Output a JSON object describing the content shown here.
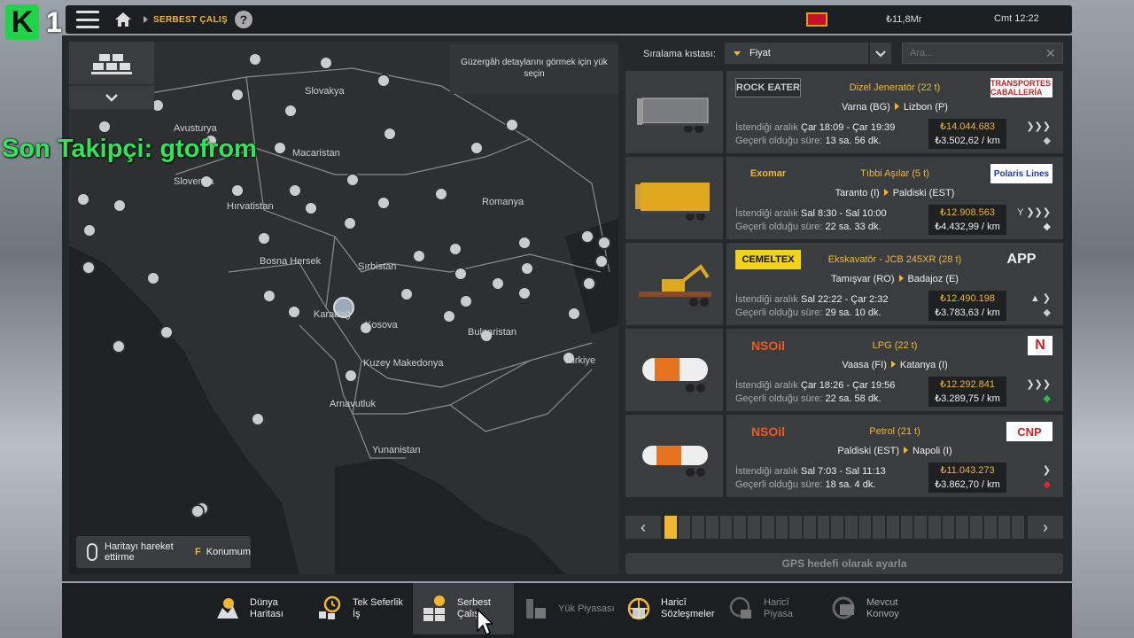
{
  "stream": {
    "logo_letter": "K",
    "logo_number": "1",
    "overlay": "Son Takipçi: gtofrom"
  },
  "topbar": {
    "breadcrumb": "SERBEST ÇALIŞ",
    "help": "?",
    "money": "₺11,8Mr",
    "time": "Cmt 12:22"
  },
  "map": {
    "tooltip": "Güzergâh detaylarını görmek için yük seçin",
    "hint_move": "Haritayı hareket ettirme",
    "hint_key": "F",
    "hint_location": "Konumum",
    "labels": {
      "bulgaria": "Bulgaristan",
      "romania": "Romanya",
      "serbia": "Sırbistan",
      "bosnia": "Bosna Hersek",
      "croatia": "Hırvatistan",
      "slovenia": "Slovenya",
      "hungary": "Macaristan",
      "slovakia": "Slovakya",
      "austria": "Avusturya",
      "kosovo": "Kosova",
      "macedonia": "Kuzey Makedonya",
      "albania": "Arnavutluk",
      "greece": "Yunanistan",
      "turkey": "Türkiye",
      "montenegro": "Karadağ"
    }
  },
  "sort": {
    "label": "Sıralama kıstası:",
    "value": "Fiyat",
    "search_placeholder": "Ara..."
  },
  "jobs": [
    {
      "company": "ROCK EATER",
      "cargo": "Dizel Jeneratör (22 t)",
      "destination_company": "TRANSPORTES CABALLERÍA",
      "from": "Varna (BG)",
      "to": "Lizbon (P)",
      "range_label": "İstendiği aralık",
      "range": "Çar 18:09 - Çar 19:39",
      "valid_label": "Geçerli olduğu süre:",
      "valid": "13 sa. 56 dk.",
      "price": "₺14.044.683",
      "per_km": "₺3.502,62 / km"
    },
    {
      "company": "Exomar",
      "cargo": "Tıbbi Aşılar (5 t)",
      "destination_company": "Polaris Lines",
      "from": "Taranto (I)",
      "to": "Paldiski (EST)",
      "range_label": "İstendiği aralık",
      "range": "Sal 8:30 - Sal 10:00",
      "valid_label": "Geçerli olduğu süre:",
      "valid": "22 sa. 33 dk.",
      "price": "₺12.908.563",
      "per_km": "₺4.432,99 / km"
    },
    {
      "company": "CEMELTEX",
      "cargo": "Ekskavatör - JCB 245XR (28 t)",
      "destination_company": "APP",
      "from": "Tamışvar (RO)",
      "to": "Badajoz (E)",
      "range_label": "İstendiği aralık",
      "range": "Sal 22:22 - Çar 2:32",
      "valid_label": "Geçerli olduğu süre:",
      "valid": "29 sa. 10 dk.",
      "price": "₺12.490.198",
      "per_km": "₺3.783,63 / km"
    },
    {
      "company": "NSOil",
      "cargo": "LPG (22 t)",
      "destination_company": "N",
      "from": "Vaasa (FI)",
      "to": "Katanya (I)",
      "range_label": "İstendiği aralık",
      "range": "Çar 18:26 - Çar 19:56",
      "valid_label": "Geçerli olduğu süre:",
      "valid": "22 sa. 58 dk.",
      "price": "₺12.292.841",
      "per_km": "₺3.289,75 / km"
    },
    {
      "company": "NSOil",
      "cargo": "Petrol (21 t)",
      "destination_company": "CNP",
      "from": "Paldiski (EST)",
      "to": "Napoli (I)",
      "range_label": "İstendiği aralık",
      "range": "Sal 7:03 - Sal 11:13",
      "valid_label": "Geçerli olduğu süre:",
      "valid": "18 sa. 4 dk.",
      "price": "₺11.043.273",
      "per_km": "₺3.862,70 / km"
    }
  ],
  "pager": {
    "prev": "‹",
    "next": "›",
    "total_pages": 26,
    "current": 1
  },
  "gps_button": "GPS hedefi olarak ayarla",
  "tabs": [
    {
      "label": "Dünya Haritası"
    },
    {
      "label": "Tek Seferlik İş"
    },
    {
      "label": "Serbest Çalış"
    },
    {
      "label": "Yük Piyasası"
    },
    {
      "label": "Haricî Sözleşmeler"
    },
    {
      "label": "Haricî Piyasa"
    },
    {
      "label": "Mevcut Konvoy"
    }
  ],
  "colors": {
    "accent": "#f2b632",
    "panel": "#3a3d40",
    "bar": "#1c1f22",
    "overlay": "#33e35a"
  }
}
